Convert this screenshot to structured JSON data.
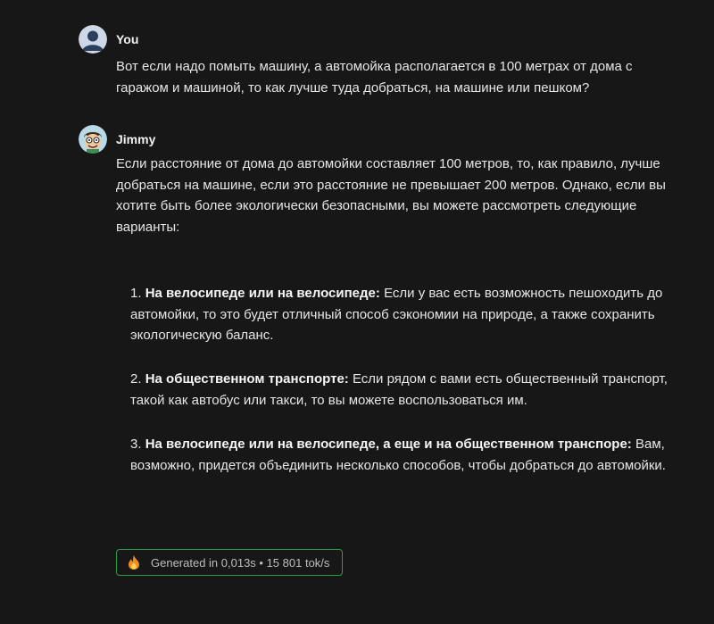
{
  "user_message": {
    "author": "You",
    "text": "Вот если надо помыть машину, а автомойка располагается в 100 метрах от дома с гаражом и машиной, то как лучше туда добраться, на машине или пешком?"
  },
  "bot_message": {
    "author": "Jimmy",
    "intro": "Если расстояние от дома до автомойки составляет 100 метров, то, как правило, лучше добраться на машине, если это расстояние не превышает 200 метров. Однако, если вы хотите быть более экологически безопасными, вы можете рассмотреть следующие варианты:",
    "items": [
      {
        "number": "1.",
        "title": "На велосипеде или на велосипеде:",
        "text": "Если у вас есть возможность пешоходить до автомойки, то это будет отличный способ сэкономии на природе, а также сохранить экологическую баланс."
      },
      {
        "number": "2.",
        "title": "На общественном транспорте:",
        "text": "Если рядом с вами есть общественный транспорт, такой как автобус или такси, то вы можете воспользоваться им."
      },
      {
        "number": "3.",
        "title": "На велосипеде или на велосипеде, а еще и на общественном транспоре:",
        "text": "Вам, возможно, придется объединить несколько способов, чтобы добраться до автомойки."
      }
    ]
  },
  "status": {
    "icon": "flame-icon",
    "text": "Generated in 0,013s • 15 801 tok/s"
  },
  "colors": {
    "background": "#171717",
    "badge_border": "#2f9a4a",
    "flame": "#f08a24"
  }
}
